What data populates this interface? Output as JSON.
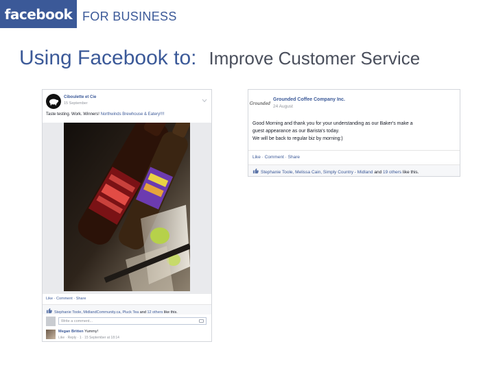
{
  "header": {
    "logo_text": "facebook",
    "subtitle": "FOR BUSINESS"
  },
  "slide": {
    "title_main": "Using Facebook to:",
    "title_sub": "Improve Customer Service"
  },
  "post_left": {
    "page_name": "Ciboulette et Cie",
    "date": "15 September",
    "text_plain": "Taste testing. Work. Winners! ",
    "text_link": "Northwinds Brewhouse & Eatery!!!!",
    "actions": "Like · Comment · Share",
    "likes": {
      "names": "Stephanie Toole, MidlandCommunity.ca, Pluck Tea",
      "and": " and ",
      "others": "12 others",
      "suffix": " like this."
    },
    "comment_placeholder": "Write a comment...",
    "comment": {
      "author": "Megan Britten",
      "text": " Yummy!",
      "meta": "Like · Reply · 1 · 15 September at 18:14"
    }
  },
  "post_right": {
    "page_name": "Grounded Coffee Company Inc.",
    "date": "24 August",
    "avatar_text": "Grounded",
    "text_line1": "Good Morning and thank you for your understanding as our Baker's make a",
    "text_line2": "guest appearance as our Barista's today.",
    "text_line3": "We will be back to regular biz by morning:)",
    "actions": "Like · Comment · Share",
    "likes": {
      "names": "Stephanie Toole, Melissa Cain, Simply Country - Midland",
      "and": " and ",
      "others": "19 others",
      "suffix": " like this."
    }
  },
  "colors": {
    "facebook_blue": "#3b5998",
    "title_gray": "#4a4f5c"
  }
}
